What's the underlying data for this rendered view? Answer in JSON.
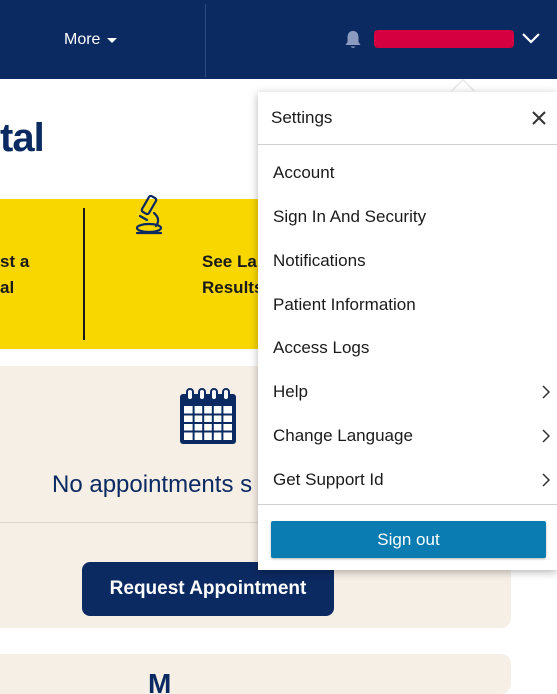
{
  "topbar": {
    "more_label": "More",
    "icons": {
      "notifications": "bell-icon",
      "menu": "chevron-down-icon"
    },
    "colors": {
      "background": "#0c2a62",
      "username_bar": "#d4003f"
    }
  },
  "page": {
    "title_fragment": "tal",
    "tiles": [
      {
        "line1": "st a",
        "line2": "al"
      },
      {
        "line1": "See La",
        "line2": "Results",
        "icon": "microscope-icon"
      }
    ],
    "appointments": {
      "icon": "calendar-icon",
      "empty_text": "No appointments s",
      "request_button": "Request Appointment"
    },
    "next_card_glyph": "M"
  },
  "settings_menu": {
    "title": "Settings",
    "close_icon": "close-icon",
    "items": [
      {
        "label": "Account"
      },
      {
        "label": "Sign In And Security"
      },
      {
        "label": "Notifications"
      },
      {
        "label": "Patient Information"
      },
      {
        "label": "Access Logs"
      },
      {
        "label": "Help",
        "submenu": true
      },
      {
        "label": "Change Language",
        "submenu": true
      },
      {
        "label": "Get Support Id",
        "submenu": true
      }
    ],
    "sign_out": "Sign out",
    "colors": {
      "sign_out_button": "#0a7cb2"
    }
  }
}
